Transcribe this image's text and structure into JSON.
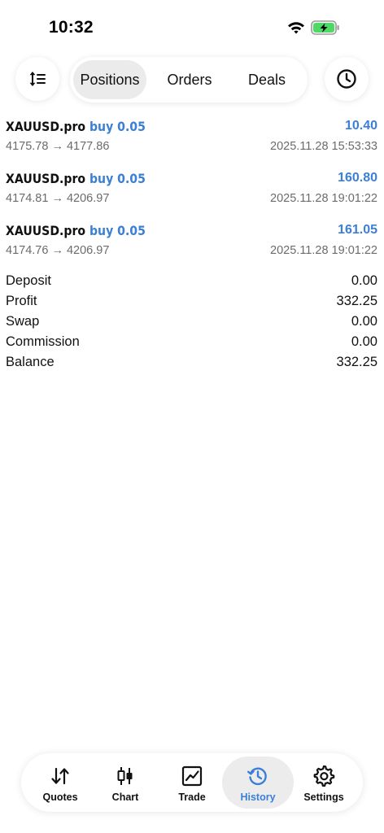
{
  "status_bar": {
    "time": "10:32"
  },
  "toolbar": {
    "tabs": [
      {
        "label": "Positions",
        "active": true
      },
      {
        "label": "Orders",
        "active": false
      },
      {
        "label": "Deals",
        "active": false
      }
    ]
  },
  "deals": [
    {
      "symbol": "XAUUSD.pro",
      "side": "buy 0.05",
      "profit": "10.40",
      "open_price": "4175.78",
      "close_price": "4177.86",
      "time": "2025.11.28 15:53:33"
    },
    {
      "symbol": "XAUUSD.pro",
      "side": "buy 0.05",
      "profit": "160.80",
      "open_price": "4174.81",
      "close_price": "4206.97",
      "time": "2025.11.28 19:01:22"
    },
    {
      "symbol": "XAUUSD.pro",
      "side": "buy 0.05",
      "profit": "161.05",
      "open_price": "4174.76",
      "close_price": "4206.97",
      "time": "2025.11.28 19:01:22"
    }
  ],
  "summary": [
    {
      "label": "Deposit",
      "value": "0.00"
    },
    {
      "label": "Profit",
      "value": "332.25"
    },
    {
      "label": "Swap",
      "value": "0.00"
    },
    {
      "label": "Commission",
      "value": "0.00"
    },
    {
      "label": "Balance",
      "value": "332.25"
    }
  ],
  "tabbar": [
    {
      "label": "Quotes",
      "icon": "quotes-arrows-icon",
      "active": false
    },
    {
      "label": "Chart",
      "icon": "candlestick-icon",
      "active": false
    },
    {
      "label": "Trade",
      "icon": "trade-chart-icon",
      "active": false
    },
    {
      "label": "History",
      "icon": "history-clock-icon",
      "active": true
    },
    {
      "label": "Settings",
      "icon": "gear-icon",
      "active": false
    }
  ],
  "colors": {
    "accent": "#3b7fd6",
    "secondary_text": "#6b6b6b",
    "active_bg": "#ececec",
    "battery_green": "#4cd964"
  }
}
